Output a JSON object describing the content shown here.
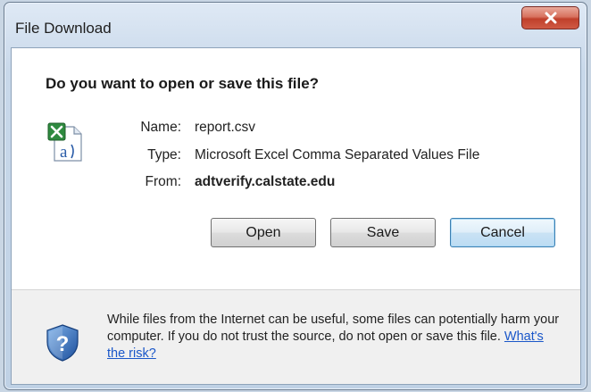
{
  "window": {
    "title": "File Download",
    "close_icon": "close-icon"
  },
  "dialog": {
    "question": "Do you want to open or save this file?",
    "file_icon": "excel-csv-file-icon",
    "fields": {
      "name_label": "Name:",
      "name_value": "report.csv",
      "type_label": "Type:",
      "type_value": "Microsoft Excel Comma Separated Values File",
      "from_label": "From:",
      "from_value": "adtverify.calstate.edu"
    },
    "buttons": {
      "open": "Open",
      "save": "Save",
      "cancel": "Cancel"
    }
  },
  "footer": {
    "shield_icon": "security-shield-question-icon",
    "warning_text": "While files from the Internet can be useful, some files can potentially harm your computer. If you do not trust the source, do not open or save this file.",
    "risk_link": "What's the risk?"
  },
  "colors": {
    "link": "#1a57c9",
    "close_button": "#c94a35",
    "default_button_border": "#3c7fb1"
  }
}
